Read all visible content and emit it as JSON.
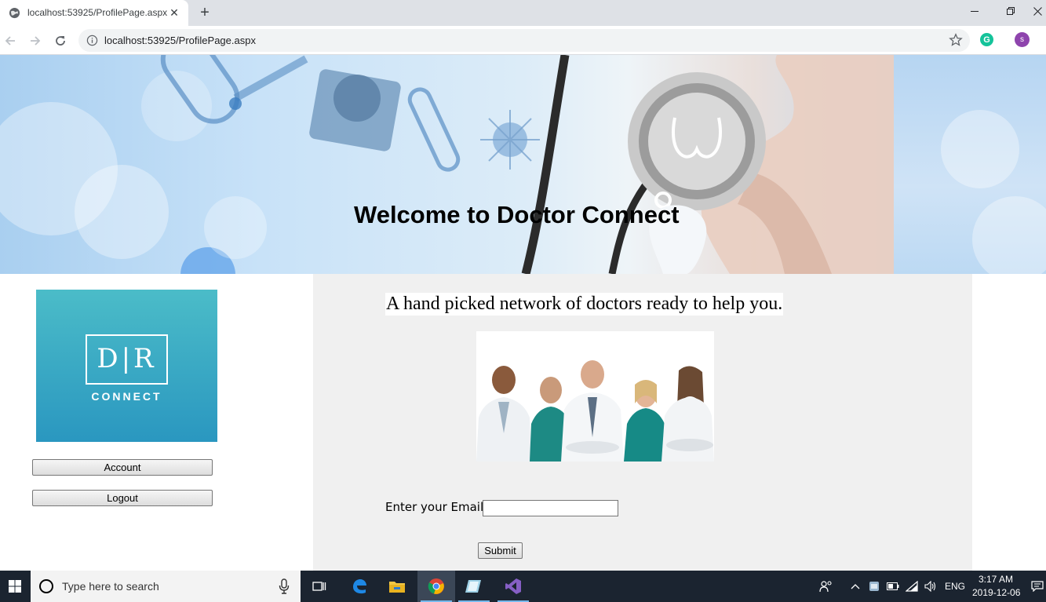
{
  "browser": {
    "tab_title": "localhost:53925/ProfilePage.aspx",
    "url": "localhost:53925/ProfilePage.aspx",
    "profile_initial": "s",
    "extension_initial": "G"
  },
  "banner": {
    "title": "Welcome to Doctor Connect"
  },
  "logo": {
    "letters": "D|R",
    "word": "CONNECT"
  },
  "sidebar": {
    "buttons": [
      {
        "label": "Account"
      },
      {
        "label": "Logout"
      }
    ]
  },
  "main": {
    "tagline": "A hand picked network of doctors ready to help you.",
    "email_label": "Enter your Email",
    "email_value": "",
    "submit_label": "Submit"
  },
  "taskbar": {
    "search_placeholder": "Type here to search",
    "language": "ENG",
    "time": "3:17 AM",
    "date": "2019-12-06"
  },
  "colors": {
    "logo_top": "#4bbcc8",
    "logo_bottom": "#2a97c0",
    "main_bg": "#f0f0f0",
    "taskbar_bg": "#1b2430"
  }
}
